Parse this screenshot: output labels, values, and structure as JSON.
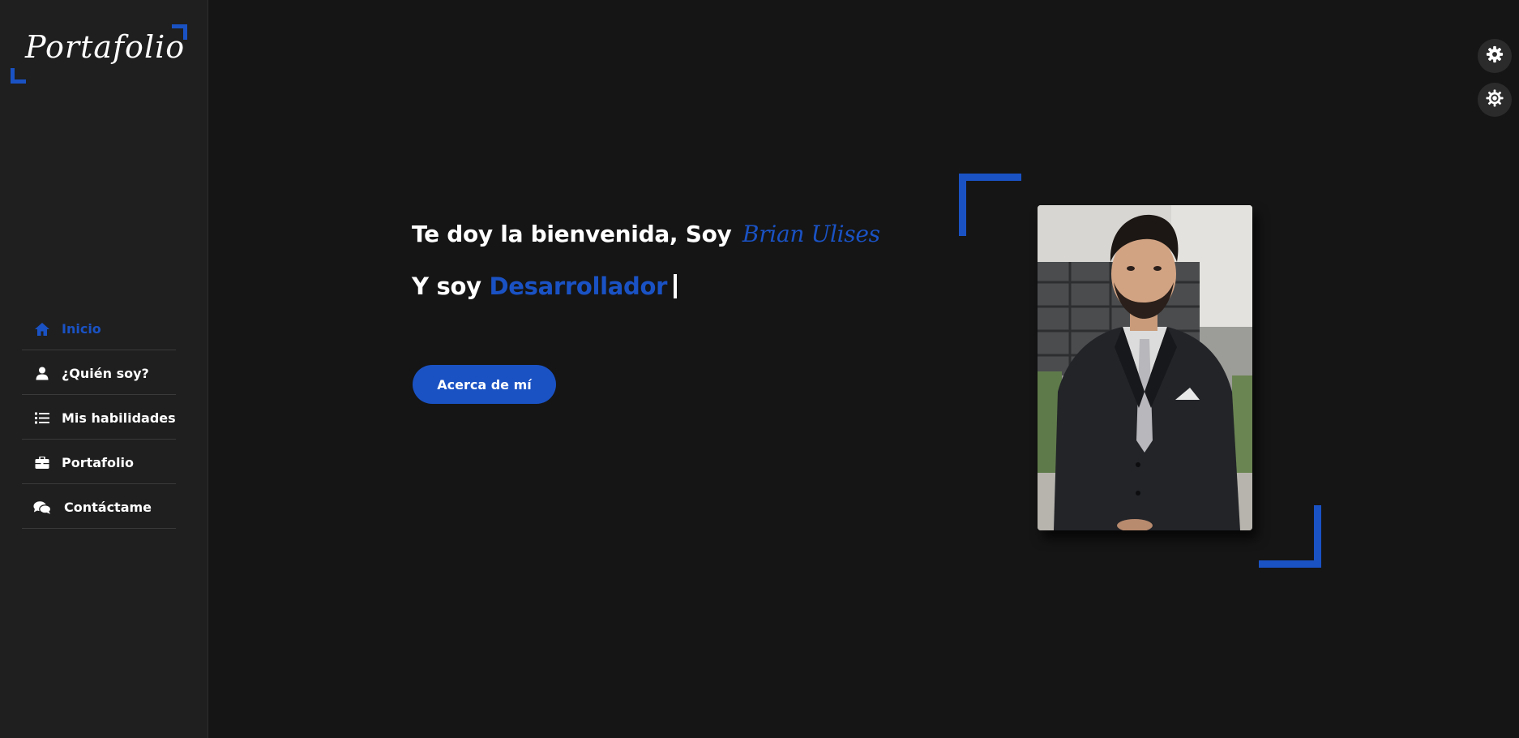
{
  "brand": {
    "logo_text": "Portafolio",
    "accent_color": "#1a52c4"
  },
  "sidebar": {
    "items": [
      {
        "label": "Inicio",
        "icon": "home-icon",
        "active": true
      },
      {
        "label": "¿Quién soy?",
        "icon": "user-icon",
        "active": false
      },
      {
        "label": "Mis habilidades",
        "icon": "list-icon",
        "active": false
      },
      {
        "label": "Portafolio",
        "icon": "briefcase-icon",
        "active": false
      },
      {
        "label": "Contáctame",
        "icon": "chat-icon",
        "active": false
      }
    ]
  },
  "hero": {
    "greeting": "Te doy la bienvenida, Soy",
    "name": "Brian Ulises",
    "role_prefix": "Y soy",
    "role": "Desarrollador",
    "button_label": "Acerca de mí"
  },
  "settings": {
    "buttons": [
      {
        "icon": "gear-icon"
      },
      {
        "icon": "sun-gear-icon"
      }
    ]
  }
}
